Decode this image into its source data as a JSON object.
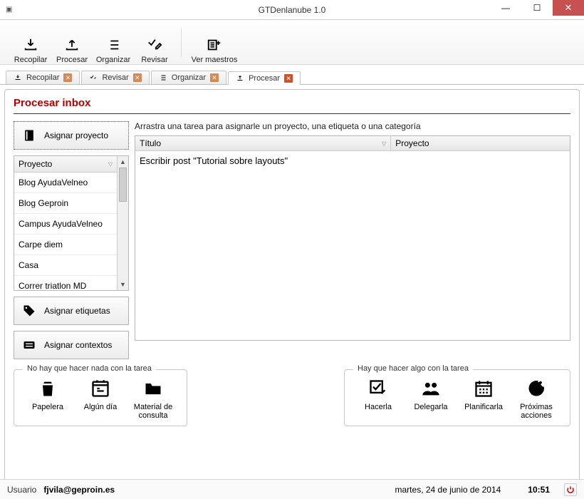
{
  "window": {
    "title": "GTDenlanube 1.0"
  },
  "toolbar": {
    "recopilar": "Recopilar",
    "procesar": "Procesar",
    "organizar": "Organizar",
    "revisar": "Revisar",
    "ver_maestros": "Ver maestros"
  },
  "tabs": {
    "recopilar": "Recopilar",
    "revisar": "Revisar",
    "organizar": "Organizar",
    "procesar": "Procesar"
  },
  "panel": {
    "title": "Procesar inbox",
    "hint": "Arrastra una tarea para asignarle un proyecto, una etiqueta o una categoría",
    "assign_project": "Asignar proyecto",
    "assign_tags": "Asignar etiquetas",
    "assign_contexts": "Asignar contextos"
  },
  "project_list": {
    "header": "Proyecto",
    "items": [
      "Blog AyudaVelneo",
      "Blog Geproin",
      "Campus AyudaVelneo",
      "Carpe diem",
      "Casa",
      "Correr triatlon MD"
    ]
  },
  "table": {
    "col_title": "Título",
    "col_project": "Proyecto",
    "rows": [
      {
        "title": "Escribir post \"Tutorial sobre layouts\"",
        "project": ""
      }
    ]
  },
  "groups": {
    "left_title": "No hay que hacer nada con la tarea",
    "right_title": "Hay que hacer algo con la tarea",
    "trash": "Papelera",
    "someday": "Algún día",
    "reference": "Material de consulta",
    "do_it": "Hacerla",
    "delegate": "Delegarla",
    "plan": "Planificarla",
    "next": "Próximas acciones"
  },
  "status": {
    "user_label": "Usuario",
    "user": "fjvila@geproin.es",
    "date": "martes, 24 de junio de 2014",
    "time": "10:51"
  }
}
